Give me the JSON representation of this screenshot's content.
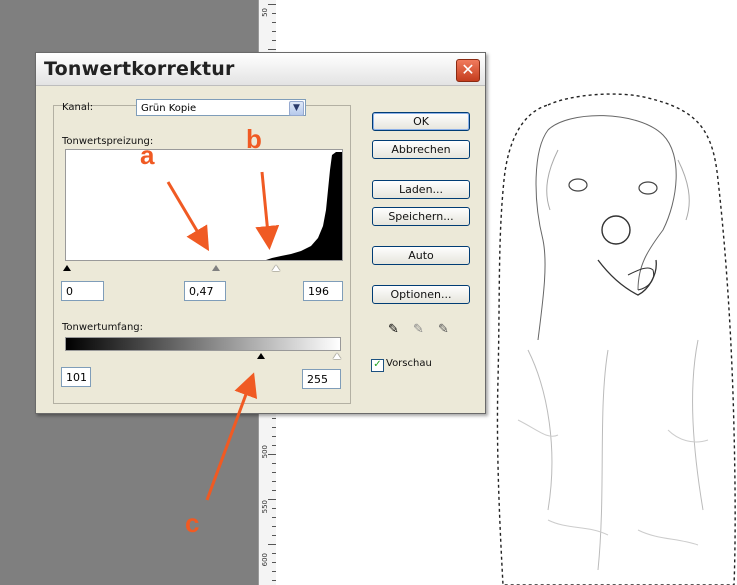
{
  "dialog": {
    "title": "Tonwertkorrektur",
    "close_glyph": "✕",
    "channel_label": "Kanal:",
    "channel_value": "Grün Kopie",
    "input_levels_label": "Tonwertspreizung:",
    "input_black": "0",
    "input_gamma": "0,47",
    "input_white": "196",
    "output_levels_label": "Tonwertumfang:",
    "output_black": "101",
    "output_white": "255",
    "buttons": {
      "ok": "OK",
      "cancel": "Abbrechen",
      "load": "Laden...",
      "save": "Speichern...",
      "auto": "Auto",
      "options": "Optionen..."
    },
    "preview_label": "Vorschau",
    "preview_checked": true
  },
  "annotations": {
    "a": "a",
    "b": "b",
    "c": "c",
    "color": "#f05a23"
  },
  "ruler": {
    "labels": [
      "50",
      "500",
      "550",
      "600"
    ]
  },
  "colors": {
    "workspace": "#7f7f7f",
    "dialog_bg": "#ece9d8",
    "close_button": "#c43d1e"
  },
  "icons": [
    "close-icon",
    "dropdown-arrow-icon",
    "black-eyedropper-icon",
    "gray-eyedropper-icon",
    "white-eyedropper-icon",
    "checkbox-icon"
  ]
}
